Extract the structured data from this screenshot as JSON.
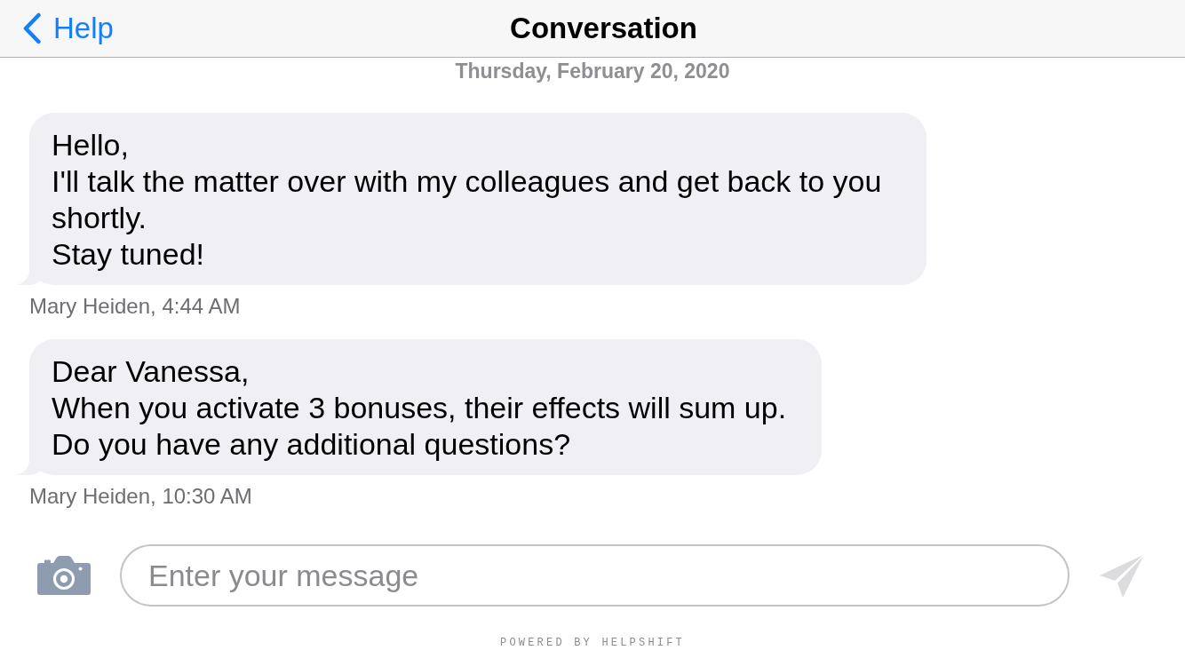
{
  "header": {
    "back_link": {
      "label": "Help"
    },
    "title": "Conversation"
  },
  "date_label": "Thursday, February 20, 2020",
  "messages": [
    {
      "text": "Hello,\nI'll talk the matter over with my colleagues and get back to you shortly.\nStay tuned!",
      "byline": "Mary Heiden, 4:44 AM"
    },
    {
      "text": "Dear Vanessa,\nWhen you activate 3 bonuses, their effects will sum up.\nDo you have any additional questions?",
      "byline": "Mary Heiden, 10:30 AM"
    }
  ],
  "composer": {
    "placeholder": "Enter your message",
    "send_button": {
      "disabled": true
    }
  },
  "footer": "POWERED BY HELPSHIFT"
}
